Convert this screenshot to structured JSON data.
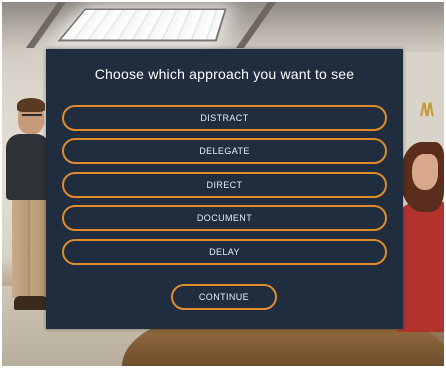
{
  "dialog": {
    "title": "Choose which approach you want to see",
    "options": [
      {
        "label": "DISTRACT"
      },
      {
        "label": "DELEGATE"
      },
      {
        "label": "DIRECT"
      },
      {
        "label": "DOCUMENT"
      },
      {
        "label": "DELAY"
      }
    ],
    "continue_label": "CONTINUE"
  },
  "colors": {
    "panel": "#1f2d3f",
    "accent": "#e08b2c",
    "text": "#ffffff"
  }
}
